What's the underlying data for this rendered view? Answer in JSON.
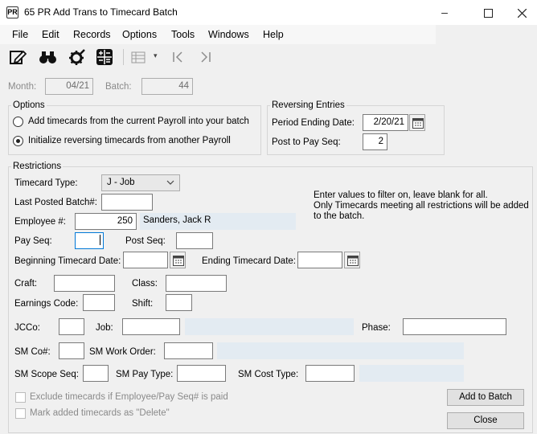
{
  "window": {
    "title": "65 PR Add Trans to Timecard Batch",
    "app_icon": "PR"
  },
  "menu": [
    "File",
    "Edit",
    "Records",
    "Options",
    "Tools",
    "Windows",
    "Help"
  ],
  "header": {
    "month_label": "Month:",
    "month_value": "04/21",
    "batch_label": "Batch:",
    "batch_value": "44"
  },
  "options": {
    "title": "Options",
    "radio1": "Add timecards from the current Payroll into your batch",
    "radio2": "Initialize reversing timecards from another Payroll",
    "selected": 2
  },
  "reversing": {
    "title": "Reversing Entries",
    "period_label": "Period Ending Date:",
    "period_value": "2/20/21",
    "post_label": "Post to Pay Seq:",
    "post_value": "2"
  },
  "restrictions": {
    "title": "Restrictions",
    "timecard_type_label": "Timecard Type:",
    "timecard_type_value": "J - Job",
    "last_batch_label": "Last Posted Batch#:",
    "last_batch_value": "",
    "employee_label": "Employee #:",
    "employee_value": "250",
    "employee_name": "Sanders, Jack R",
    "payseq_label": "Pay Seq:",
    "payseq_value": "",
    "postseq_label": "Post Seq:",
    "postseq_value": "",
    "begin_date_label": "Beginning Timecard Date:",
    "begin_date_value": "",
    "end_date_label": "Ending Timecard Date:",
    "end_date_value": "",
    "craft_label": "Craft:",
    "craft_value": "",
    "class_label": "Class:",
    "class_value": "",
    "earnings_label": "Earnings Code:",
    "earnings_value": "",
    "shift_label": "Shift:",
    "shift_value": "",
    "jcco_label": "JCCo:",
    "jcco_value": "",
    "job_label": "Job:",
    "job_value": "",
    "phase_label": "Phase:",
    "phase_value": "",
    "smco_label": "SM Co#:",
    "smco_value": "",
    "sm_workorder_label": "SM Work Order:",
    "sm_workorder_value": "",
    "sm_scope_label": "SM Scope Seq:",
    "sm_scope_value": "",
    "sm_paytype_label": "SM Pay Type:",
    "sm_paytype_value": "",
    "sm_costtype_label": "SM Cost Type:",
    "sm_costtype_value": "",
    "info_line1": "Enter values to filter on, leave blank for all.",
    "info_line2": "Only Timecards meeting all restrictions will be added",
    "info_line3": "to the batch."
  },
  "footer": {
    "exclude_label": "Exclude timecards if Employee/Pay Seq# is paid",
    "delete_label": "Mark added timecards as \"Delete\"",
    "add_button": "Add to Batch",
    "close_button": "Close"
  },
  "icons": [
    "app-icon",
    "minimize-icon",
    "maximize-icon",
    "close-icon",
    "edit-icon",
    "binoculars-icon",
    "settings-icon",
    "calculator-icon",
    "grid-icon",
    "dropdown-arrow-icon",
    "first-record-icon",
    "last-record-icon",
    "calendar-icon",
    "chevron-down-icon"
  ]
}
